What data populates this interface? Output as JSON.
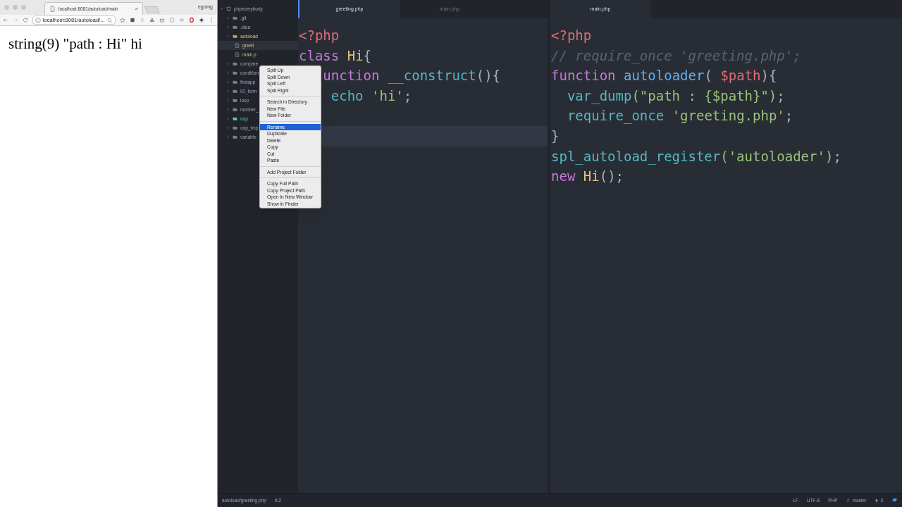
{
  "browser": {
    "tab_title": "localhost:8081/autoload/main",
    "tab_close": "×",
    "user": "egoing",
    "address": "localhost:8081/autoload/...",
    "content": "string(9) \"path : Hi\" hi"
  },
  "tree": {
    "label": "phpeverybody",
    "expanded": true,
    "children": [
      {
        "label": ".git",
        "kind": "folder",
        "expanded": false
      },
      {
        "label": ".idea",
        "kind": "folder",
        "expanded": false
      },
      {
        "label": "autoload",
        "kind": "folder",
        "expanded": true,
        "children": [
          {
            "label": "greeti",
            "kind": "file",
            "selected": true
          },
          {
            "label": "main.p",
            "kind": "file",
            "selected": false
          }
        ]
      },
      {
        "label": "compare",
        "kind": "folder",
        "expanded": false
      },
      {
        "label": "condition",
        "kind": "folder",
        "expanded": false
      },
      {
        "label": "firstapp",
        "kind": "folder",
        "expanded": false
      },
      {
        "label": "IO_form",
        "kind": "folder",
        "expanded": false
      },
      {
        "label": "loop",
        "kind": "folder",
        "expanded": false
      },
      {
        "label": "number_",
        "kind": "folder",
        "expanded": false
      },
      {
        "label": "oop",
        "kind": "folder",
        "expanded": false,
        "color": "#73c990"
      },
      {
        "label": "oop_tmp",
        "kind": "folder",
        "expanded": false
      },
      {
        "label": "variable",
        "kind": "folder",
        "expanded": false
      }
    ]
  },
  "context_menu": [
    [
      {
        "label": "Split Up",
        "selected": false
      },
      {
        "label": "Split Down",
        "selected": false
      },
      {
        "label": "Split Left",
        "selected": false
      },
      {
        "label": "Split Right",
        "selected": false
      }
    ],
    [
      {
        "label": "Search in Directory",
        "selected": false
      },
      {
        "label": "New File",
        "selected": false
      },
      {
        "label": "New Folder",
        "selected": false
      }
    ],
    [
      {
        "label": "Rename",
        "selected": true
      },
      {
        "label": "Duplicate",
        "selected": false
      },
      {
        "label": "Delete",
        "selected": false
      },
      {
        "label": "Copy",
        "selected": false
      },
      {
        "label": "Cut",
        "selected": false
      },
      {
        "label": "Paste",
        "selected": false
      }
    ],
    [
      {
        "label": "Add Project Folder",
        "selected": false
      }
    ],
    [
      {
        "label": "Copy Full Path",
        "selected": false
      },
      {
        "label": "Copy Project Path",
        "selected": false
      },
      {
        "label": "Open In New Window",
        "selected": false
      },
      {
        "label": "Show in Finder",
        "selected": false
      }
    ]
  ],
  "panes": [
    {
      "tabs": [
        {
          "label": "greeting.php",
          "selected": true
        },
        {
          "label": "main.php",
          "selected": false
        }
      ],
      "lines": [
        {
          "tokens": [
            {
              "t": "<?php",
              "kind": "tag"
            }
          ],
          "cursor": false
        },
        {
          "tokens": [
            {
              "t": "class",
              "kind": "keyword"
            },
            {
              "t": "Hi",
              "kind": "class"
            },
            {
              "t": "{",
              "kind": "plain"
            }
          ],
          "cursor": false
        },
        {
          "tokens": [
            {
              "t": "   unction",
              "kind": "keyword"
            },
            {
              "t": "__construct",
              "kind": "builtin"
            },
            {
              "t": "(){",
              "kind": "plain"
            }
          ],
          "cursor": false
        },
        {
          "tokens": [
            {
              "t": "    echo",
              "kind": "builtin"
            },
            {
              "t": "'hi'",
              "kind": "string"
            },
            {
              "t": ";",
              "kind": "plain"
            }
          ],
          "cursor": false
        },
        {
          "cursor": false
        },
        {
          "cursor": true
        }
      ]
    },
    {
      "tabs": [
        {
          "label": "main.php",
          "selected": true
        }
      ],
      "lines": [
        {
          "tokens": [
            {
              "t": "<?php",
              "kind": "tag"
            }
          ]
        },
        {
          "tokens": [
            {
              "t": "// require_once 'greeting.php';",
              "kind": "comment"
            }
          ]
        },
        {
          "tokens": [
            {
              "t": "function",
              "kind": "keyword"
            },
            {
              "t": "autoloader",
              "kind": "func"
            },
            {
              "t": "(",
              "kind": "plain"
            },
            {
              "t": "$path",
              "kind": "variable"
            },
            {
              "t": "){",
              "kind": "plain"
            }
          ]
        },
        {
          "tokens": [
            {
              "t": "  var_dump",
              "kind": "builtin"
            },
            {
              "t": "(\"path : {$path}\")",
              "kind": "string"
            },
            {
              "t": ";",
              "kind": "plain"
            }
          ]
        },
        {
          "tokens": [
            {
              "t": "  require_once",
              "kind": "builtin"
            },
            {
              "t": "'greeting.php'",
              "kind": "string"
            },
            {
              "t": ";",
              "kind": "plain"
            }
          ]
        },
        {
          "tokens": [
            {
              "t": "}",
              "kind": "plain"
            }
          ]
        },
        {
          "tokens": [
            {
              "t": "spl_autoload_register",
              "kind": "builtin"
            },
            {
              "t": "('autoloader')",
              "kind": "string"
            },
            {
              "t": ";",
              "kind": "plain"
            }
          ]
        },
        {
          "tokens": [
            {
              "t": "new",
              "kind": "keyword"
            },
            {
              "t": "Hi",
              "kind": "class"
            },
            {
              "t": "();",
              "kind": "plain"
            }
          ]
        }
      ]
    }
  ],
  "status_bar": {
    "file": "autoload/greeting.php",
    "position": "6:2",
    "line_ending": "LF",
    "encoding": "UTF-8",
    "grammar": "PHP",
    "branch": "master",
    "ahead": "3"
  }
}
